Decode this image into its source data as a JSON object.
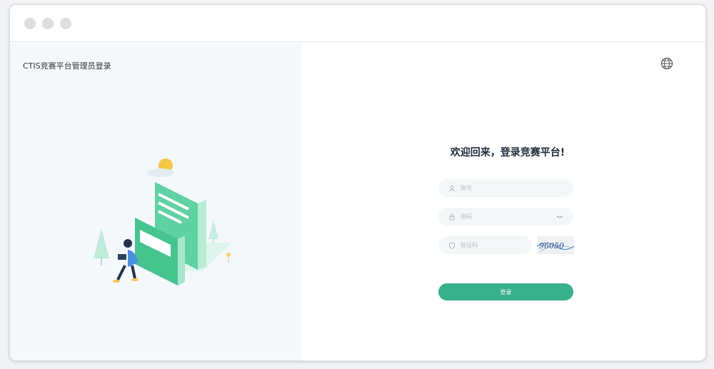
{
  "app": {
    "brand_title": "CTIS竞赛平台管理员登录"
  },
  "login": {
    "welcome_title": "欢迎回来，登录竞赛平台!",
    "username_placeholder": "账号",
    "password_placeholder": "密码",
    "captcha_placeholder": "验证码",
    "captcha_text": "96050",
    "submit_label": "登录"
  },
  "icons": {
    "language": "globe-icon",
    "username": "user-icon",
    "password": "lock-icon",
    "captcha": "shield-icon",
    "toggle_password": "eye-closed-icon"
  },
  "colors": {
    "accent": "#38b08b",
    "left_panel_bg": "#f4f8fb",
    "input_bg": "#f3f7f8",
    "title_text": "#1d2b3a"
  }
}
